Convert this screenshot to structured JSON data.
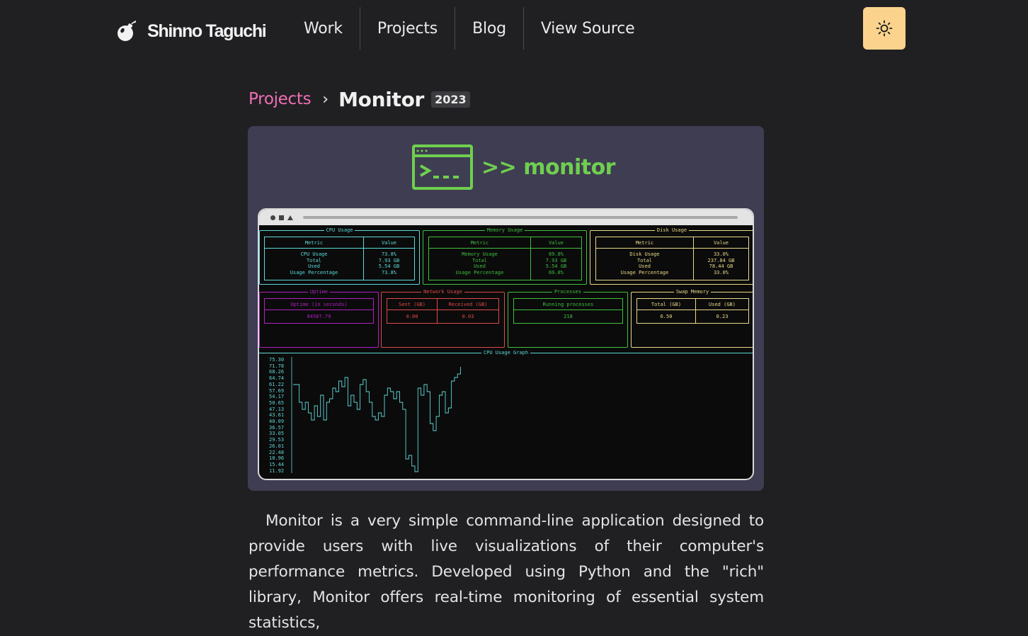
{
  "nav": {
    "logo_text": "Shinno Taguchi",
    "links": [
      "Work",
      "Projects",
      "Blog",
      "View Source"
    ],
    "theme_toggle_icon": "sun-icon",
    "accent": "#fbd38d"
  },
  "breadcrumb": {
    "parent": "Projects",
    "separator": "›",
    "title": "Monitor",
    "year": "2023",
    "parent_color": "#f06fb5"
  },
  "hero": {
    "brand_text": ">> monitor",
    "brand_color": "#6fcf4f",
    "terminal": {
      "cpu": {
        "title": "CPU Usage",
        "color": "#5fd7d7",
        "headers": [
          "Metric",
          "Value"
        ],
        "metrics": [
          "CPU Usage",
          "Total",
          "Used",
          "Usage Percentage"
        ],
        "values": [
          "73.8%",
          "7.93 GB",
          "5.54 GB",
          "73.8%"
        ]
      },
      "memory": {
        "title": "Memory Usage",
        "color": "#3fbf3f",
        "headers": [
          "Metric",
          "Value"
        ],
        "metrics": [
          "Memory Usage",
          "Total",
          "Used",
          "Usage Percentage"
        ],
        "values": [
          "69.8%",
          "7.93 GB",
          "5.54 GB",
          "69.8%"
        ]
      },
      "disk": {
        "title": "Disk Usage",
        "color": "#e8d88a",
        "headers": [
          "Metric",
          "Value"
        ],
        "metrics": [
          "Disk Usage",
          "Total",
          "Used",
          "Usage Percentage"
        ],
        "values": [
          "33.0%",
          "237.84 GB",
          "78.44 GB",
          "33.0%"
        ]
      },
      "uptime": {
        "title": "Uptime",
        "color": "#b020c0",
        "header": "Uptime (in seconds)",
        "value": "84587.79"
      },
      "network": {
        "title": "Network Usage",
        "color": "#e04848",
        "headers": [
          "Sent (GB)",
          "Received (GB)"
        ],
        "values": [
          "0.00",
          "0.03"
        ]
      },
      "processes": {
        "title": "Processes",
        "color": "#3fbf3f",
        "header": "Running processes",
        "value": "218"
      },
      "swap": {
        "title": "Swap Memory",
        "color": "#e8d88a",
        "headers": [
          "Total (GB)",
          "Used (GB)"
        ],
        "values": [
          "6.50",
          "0.23"
        ]
      },
      "graph": {
        "title": "CPU Usage Graph",
        "color": "#5fd7d7",
        "y_ticks": [
          "75.30",
          "71.78",
          "68.26",
          "64.74",
          "61.22",
          "57.69",
          "54.17",
          "50.65",
          "47.13",
          "43.61",
          "40.09",
          "36.57",
          "33.05",
          "29.53",
          "26.01",
          "22.48",
          "18.96",
          "15.44",
          "11.92"
        ]
      }
    }
  },
  "description": "Monitor is a very simple command-line application designed to provide users with live visualizations of their computer's performance metrics. Developed using Python and the \"rich\" library, Monitor offers real-time monitoring of essential system statistics,"
}
